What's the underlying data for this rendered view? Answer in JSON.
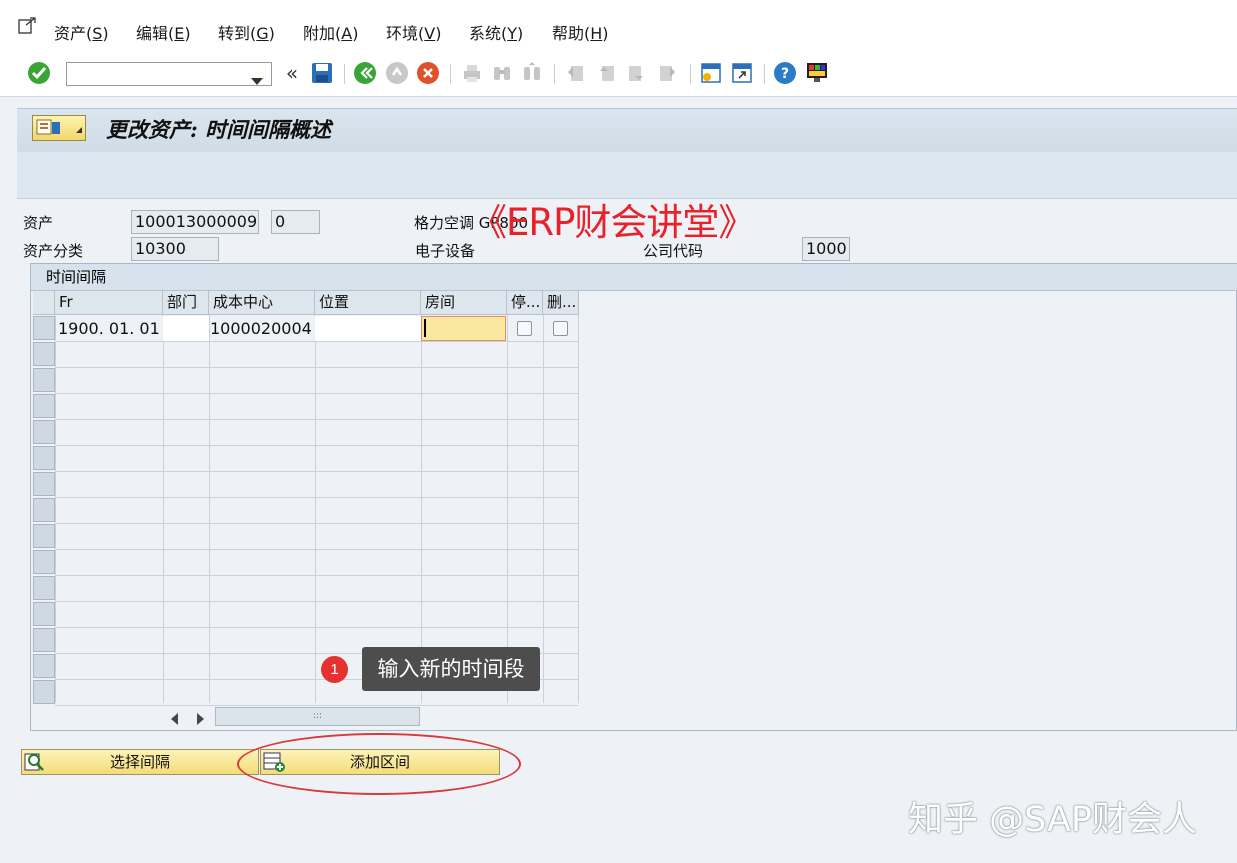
{
  "menu": {
    "items": [
      {
        "label": "资产(",
        "key": "S",
        "end": ")"
      },
      {
        "label": "编辑(",
        "key": "E",
        "end": ")"
      },
      {
        "label": "转到(",
        "key": "G",
        "end": ")"
      },
      {
        "label": "附加(",
        "key": "A",
        "end": ")"
      },
      {
        "label": "环境(",
        "key": "V",
        "end": ")"
      },
      {
        "label": "系统(",
        "key": "Y",
        "end": ")"
      },
      {
        "label": "帮助(",
        "key": "H",
        "end": ")"
      }
    ]
  },
  "toolbar": {
    "collapse_glyph": "«",
    "icons": [
      "enter-icon",
      "command-field",
      "collapse-icon",
      "save-icon",
      "back-icon",
      "exit-icon",
      "cancel-icon",
      "print-icon",
      "find-icon",
      "find-next-icon",
      "first-page-icon",
      "prev-page-icon",
      "next-page-icon",
      "last-page-icon",
      "new-session-icon",
      "shortcut-icon",
      "help-icon",
      "customize-layout-icon"
    ]
  },
  "title": {
    "text": "更改资产: 时间间隔概述"
  },
  "header": {
    "asset_label": "资产",
    "asset_main": "100013000009",
    "asset_sub": "0",
    "description": "格力空调 GP800",
    "class_label": "资产分类",
    "class_value": "10300",
    "class_text": "电子设备",
    "company_label": "公司代码",
    "company_value": "1000"
  },
  "table": {
    "title": "时间间隔",
    "columns": [
      "Fr",
      "部门",
      "成本中心",
      "位置",
      "房间",
      "停...",
      "删..."
    ],
    "rows": [
      {
        "fr": "1900. 01. 01",
        "dept": "",
        "cost_center": "1000020004",
        "location": "",
        "room": "",
        "stop": false,
        "delete": false
      }
    ],
    "scroll_glyph": ":::"
  },
  "tooltip": {
    "badge": "1",
    "text": "输入新的时间段"
  },
  "buttons": {
    "select_interval": "选择间隔",
    "add_interval": "添加区间"
  },
  "watermarks": {
    "erp": "《ERP财会讲堂》",
    "zhihu": "知乎 @SAP财会人"
  },
  "colors": {
    "accent_red": "#e8212a",
    "button_yellow": "#f3dc78",
    "input_highlight": "#fae8a0"
  }
}
